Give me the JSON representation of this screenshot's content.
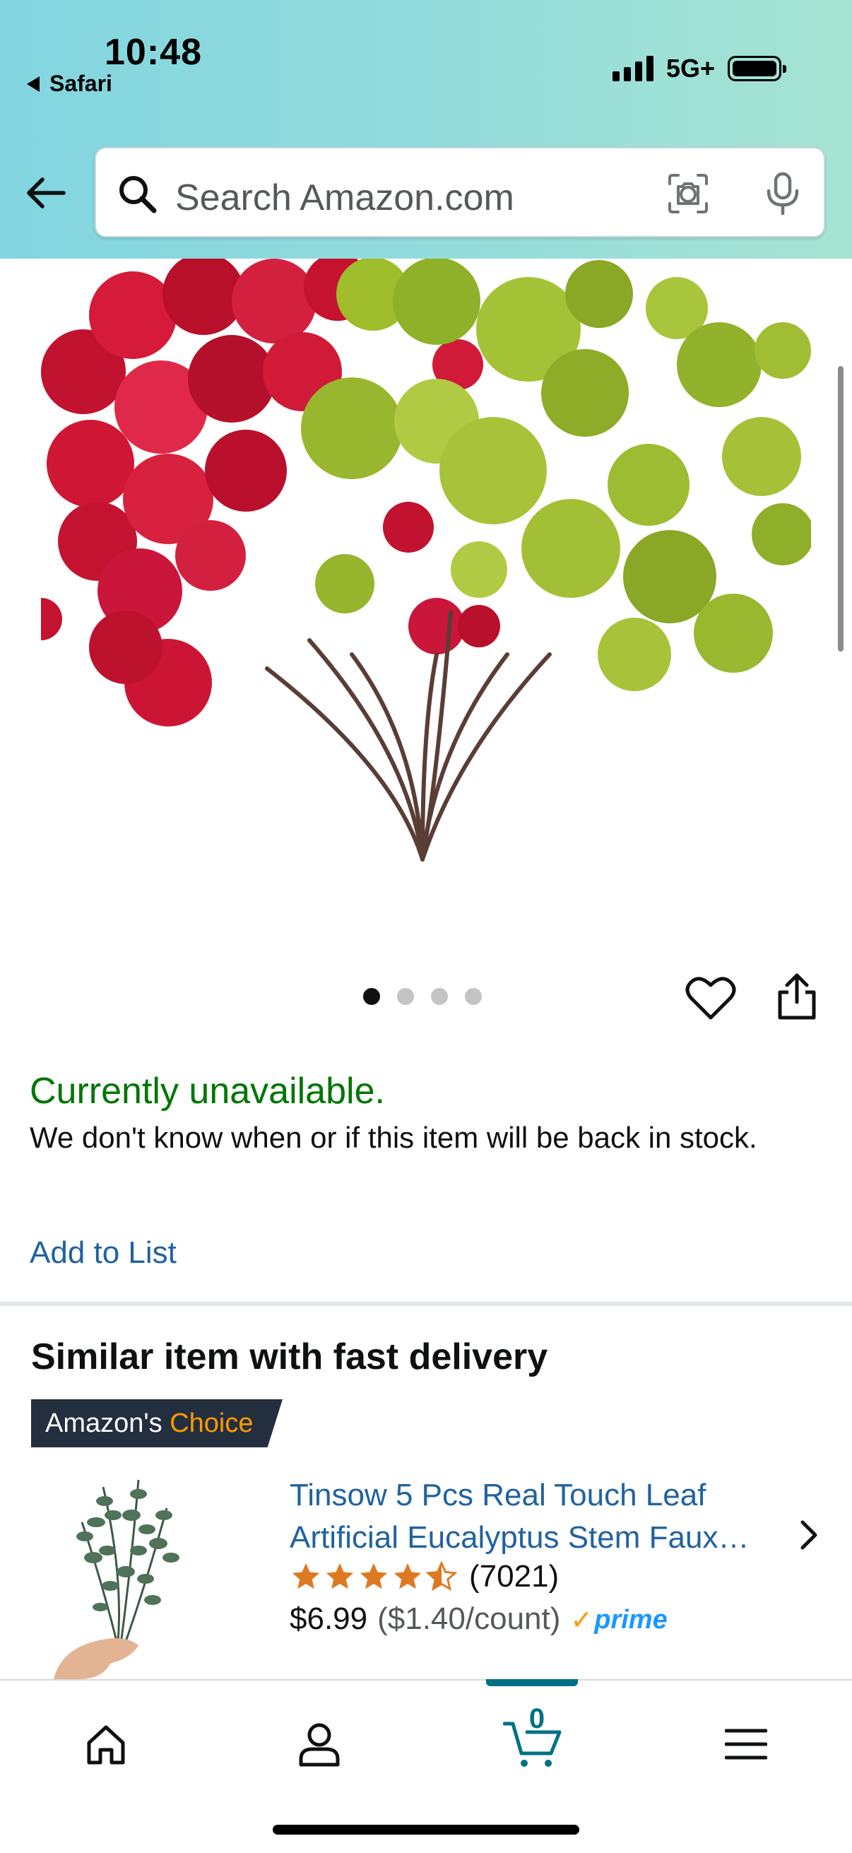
{
  "status_bar": {
    "time": "10:48",
    "back_app": "Safari",
    "network": "5G+"
  },
  "search": {
    "placeholder": "Search Amazon.com",
    "icons": [
      "back-arrow-icon",
      "search-icon",
      "camera-icon",
      "microphone-icon"
    ]
  },
  "product": {
    "image_count": 4,
    "active_image": 1,
    "availability": "Currently unavailable.",
    "availability_message": "We don't know when or if this item will be back in stock.",
    "add_to_list": "Add to List"
  },
  "similar": {
    "title": "Similar item with fast delivery",
    "badge_prefix": "Amazon's",
    "badge_highlight": "Choice",
    "name_line1": "Tinsow 5 Pcs Real Touch Leaf",
    "name_line2": "Artificial Eucalyptus Stem Faux…",
    "rating": 4.5,
    "review_count": "(7021)",
    "price": "$6.99",
    "unit_price": "($1.40/count)",
    "prime": "prime"
  },
  "tabbar": {
    "cart_count": "0",
    "items": [
      "home-icon",
      "account-icon",
      "cart-icon",
      "menu-icon"
    ]
  },
  "colors": {
    "header_gradient_start": "#82d5e0",
    "header_gradient_end": "#a6e4d2",
    "unavailable_green": "#007600",
    "link_blue": "#2162a1",
    "star_orange": "#de7921",
    "badge_navy": "#232f3e",
    "badge_orange": "#ff9900",
    "cart_teal": "#007185",
    "prime_blue": "#1a98ff"
  }
}
